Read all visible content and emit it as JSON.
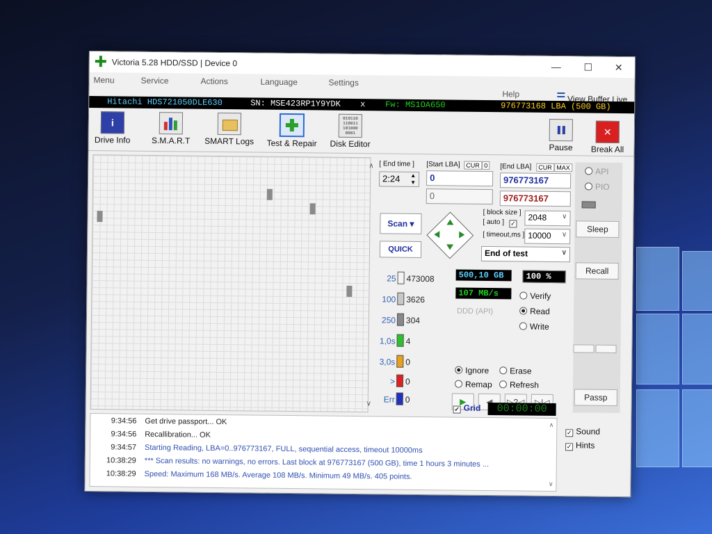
{
  "window": {
    "title": "Victoria 5.28 HDD/SSD | Device 0",
    "controls": [
      "—",
      "☐",
      "✕"
    ]
  },
  "menu": {
    "items": [
      "Menu",
      "Service",
      "Actions",
      "Language",
      "Settings",
      "Help"
    ],
    "view_buffer": "View Buffer Live"
  },
  "device": {
    "model": "Hitachi HDS721050DLE630",
    "serial": "SN: MSE423RP1Y9YDK",
    "close": "x",
    "firmware": "Fw: MS1OA650",
    "capacity": "976773168 LBA (500 GB)"
  },
  "toolbar": {
    "drive_info": "Drive Info",
    "smart": "S.M.A.R.T",
    "smart_logs": "SMART Logs",
    "test_repair": "Test & Repair",
    "disk_editor": "Disk Editor",
    "pause": "Pause",
    "break_all": "Break All",
    "info_glyph": "i",
    "break_glyph": "✕",
    "bin_glyph": "010110 110011 101000 0001"
  },
  "test": {
    "end_time_label": "[ End time ]",
    "end_time": "2:24",
    "start_lba_label": "[Start LBA]",
    "cur": "CUR",
    "zero": "0",
    "start_lba": "0",
    "end_lba_label": "[End LBA]",
    "max": "MAX",
    "end_lba": "976773167",
    "current_lba": "0",
    "end_lba_2": "976773167",
    "block_size_label": "[ block size ]",
    "auto_label": "[ auto ]",
    "block_size": "2048",
    "timeout_label": "[ timeout,ms ]",
    "timeout": "10000",
    "scan": "Scan ▾",
    "quick": "QUICK",
    "end_action": "End of test"
  },
  "stats": [
    {
      "threshold": "25",
      "count": "473008",
      "color": "#f4f4f4"
    },
    {
      "threshold": "100",
      "count": "3626",
      "color": "#c8c8c8"
    },
    {
      "threshold": "250",
      "count": "304",
      "color": "#888888"
    },
    {
      "threshold": "1,0s",
      "count": "4",
      "color": "#2fbf2f"
    },
    {
      "threshold": "3,0s",
      "count": "0",
      "color": "#e8a020"
    },
    {
      "threshold": ">",
      "count": "0",
      "color": "#e02020"
    },
    {
      "threshold": "Err",
      "count": "0",
      "color": "#2030c0"
    }
  ],
  "progress": {
    "size": "500,10 GB",
    "percent": "100",
    "percent_sign": "%",
    "speed": "107 MB/s",
    "ddd": "DDD (API)"
  },
  "modes": {
    "verify": "Verify",
    "read": "Read",
    "write": "Write"
  },
  "repair": {
    "ignore": "Ignore",
    "erase": "Erase",
    "remap": "Remap",
    "refresh": "Refresh"
  },
  "grid_label": "Grid",
  "timer": "00:00:00",
  "side": {
    "api": "API",
    "pio": "PIO",
    "sleep": "Sleep",
    "recall": "Recall",
    "passp": "Passp"
  },
  "options": {
    "sound": "Sound",
    "hints": "Hints"
  },
  "log": [
    {
      "time": "9:34:56",
      "msg": "Get drive passport... OK",
      "ok": true
    },
    {
      "time": "9:34:56",
      "msg": "Recallibration... OK",
      "ok": true
    },
    {
      "time": "9:34:57",
      "msg": "Starting Reading, LBA=0..976773167, FULL, sequential access, timeout 10000ms",
      "ok": false
    },
    {
      "time": "10:38:29",
      "msg": "*** Scan results: no warnings, no errors. Last block at 976773167 (500 GB), time 1 hours 3 minutes ...",
      "ok": false
    },
    {
      "time": "10:38:29",
      "msg": "Speed: Maximum 168 MB/s. Average 108 MB/s. Minimum 49 MB/s. 405 points.",
      "ok": false
    }
  ],
  "colors": {
    "accent": "#2a6ad0",
    "device_bar": "#000000",
    "info_cyan": "#5fd0ff",
    "speed_green": "#20d020"
  }
}
